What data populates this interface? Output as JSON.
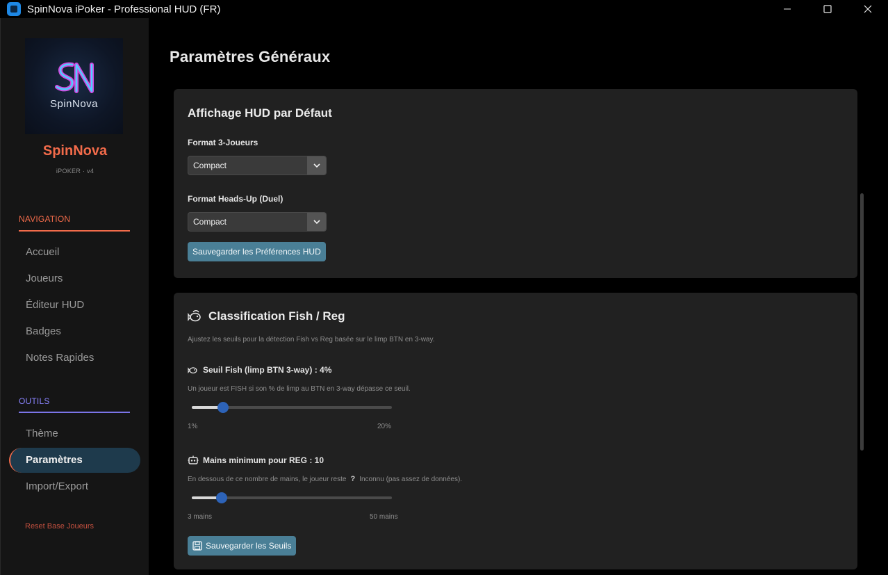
{
  "window": {
    "title": "SpinNova iPoker - Professional HUD (FR)"
  },
  "sidebar": {
    "logo_text": "SpinNova",
    "brand_name": "SpinNova",
    "brand_sub": "iPOKER · v4",
    "navigation": {
      "heading": "NAVIGATION",
      "items": [
        {
          "label": "Accueil"
        },
        {
          "label": "Joueurs"
        },
        {
          "label": "Éditeur HUD"
        },
        {
          "label": "Badges"
        },
        {
          "label": "Notes Rapides"
        }
      ]
    },
    "tools": {
      "heading": "OUTILS",
      "items": [
        {
          "label": "Thème",
          "active": false
        },
        {
          "label": "Paramètres",
          "active": true
        },
        {
          "label": "Import/Export",
          "active": false
        }
      ]
    },
    "reset_label": "Reset Base Joueurs"
  },
  "main": {
    "page_title": "Paramètres Généraux",
    "hud_card": {
      "title": "Affichage HUD par Défaut",
      "format3_label": "Format 3-Joueurs",
      "format3_value": "Compact",
      "formatHU_label": "Format Heads-Up (Duel)",
      "formatHU_value": "Compact",
      "save_label": "Sauvegarder les Préférences HUD"
    },
    "class_card": {
      "title": "Classification Fish / Reg",
      "description": "Ajustez les seuils pour la détection Fish vs Reg basée sur le limp BTN en 3-way.",
      "fish": {
        "label": "Seuil Fish (limp BTN 3-way) : 4%",
        "description": "Un joueur est FISH si son % de limp au BTN en 3-way dépasse ce seuil.",
        "min": 1,
        "max": 20,
        "value": 4,
        "min_label": "1%",
        "max_label": "20%"
      },
      "reg": {
        "label": "Mains minimum pour REG : 10",
        "description_before": "En dessous de ce nombre de mains, le joueur reste",
        "unknown_glyph": "?",
        "description_after": "Inconnu (pas assez de données).",
        "min": 3,
        "max": 50,
        "value": 10,
        "min_label": "3 mains",
        "max_label": "50 mains"
      },
      "save_label": "Sauvegarder les Seuils"
    }
  },
  "icons": {
    "fish": "fish-icon",
    "reg": "robot-icon",
    "save": "floppy-disk-icon",
    "caret": "chevron-down-icon"
  },
  "colors": {
    "accent_orange": "#f26b4a",
    "accent_purple": "#8a84ff",
    "button_blue": "#4a7f96",
    "slider_thumb": "#2d63b8",
    "active_nav_bg": "#1e3a4c"
  }
}
